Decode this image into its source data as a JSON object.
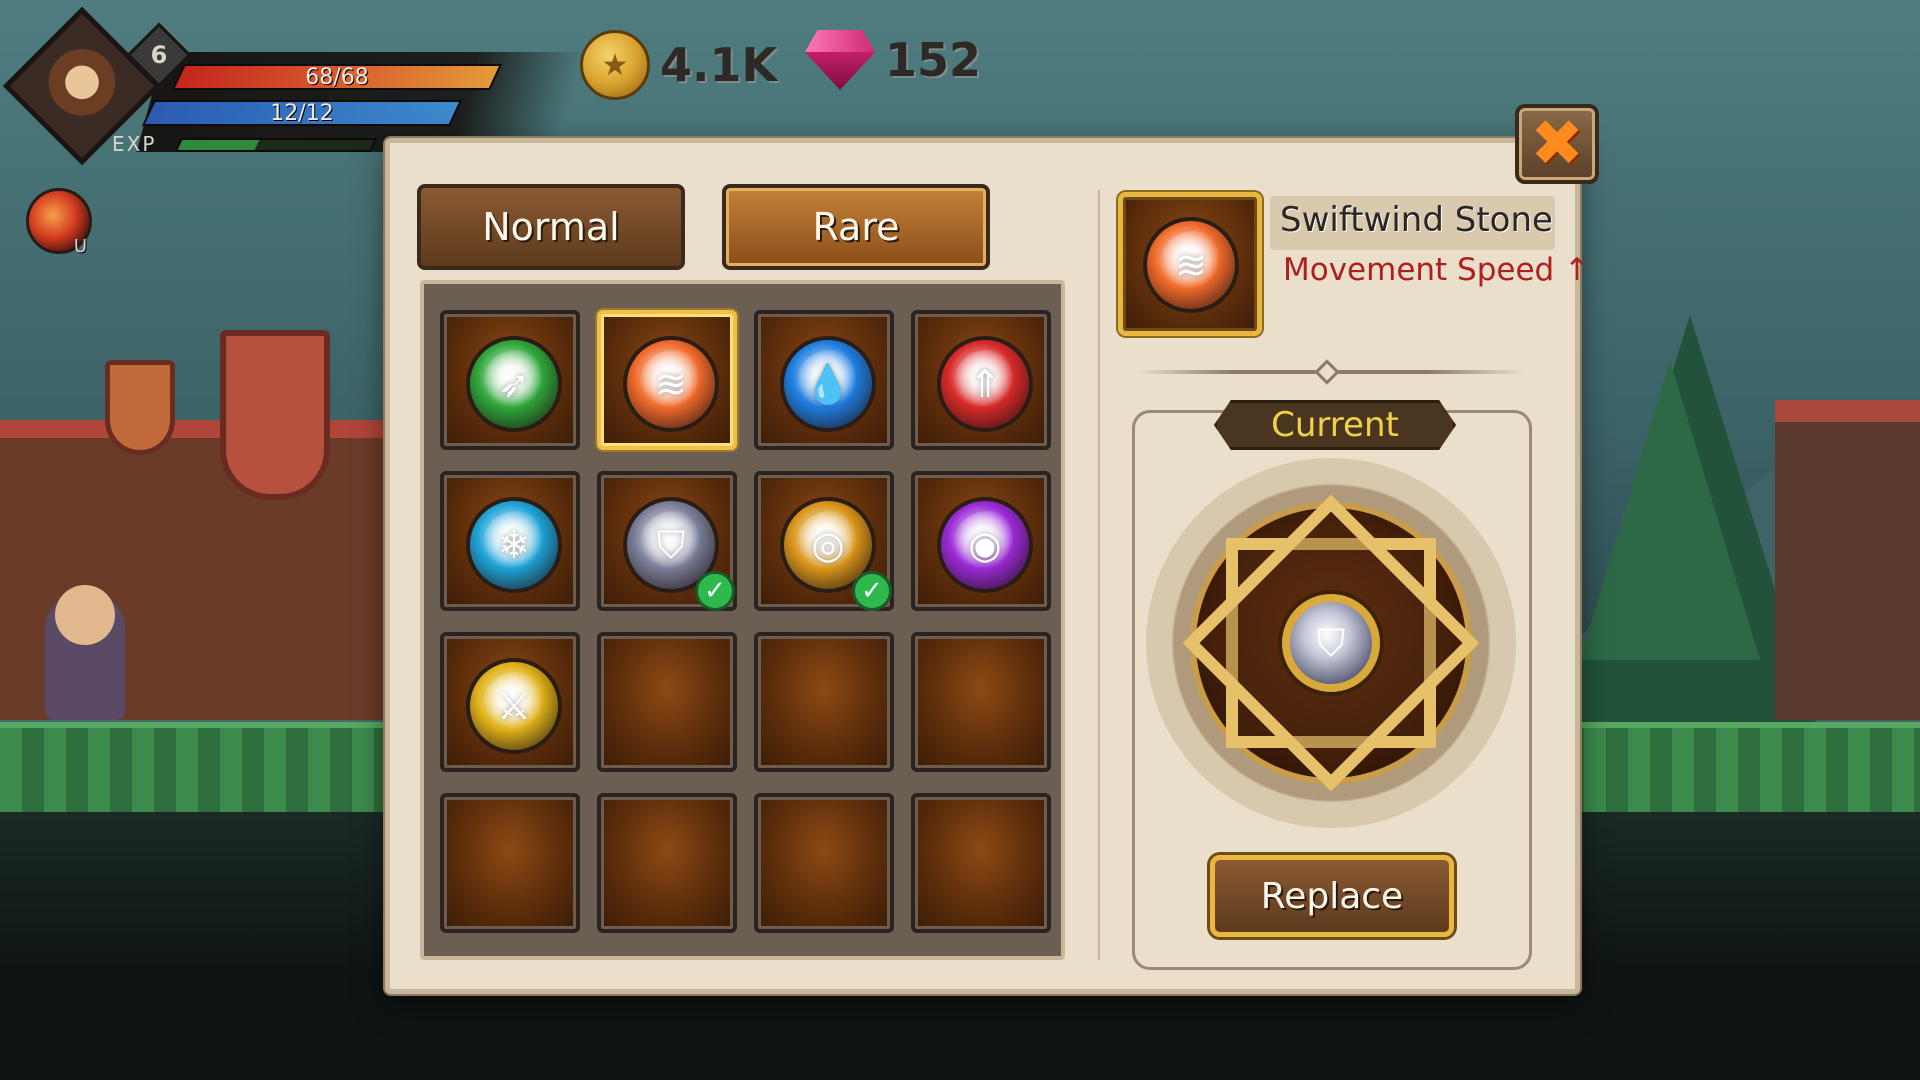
{
  "hud": {
    "level": "6",
    "hp_text": "68/68",
    "mp_text": "12/12",
    "exp_label": "EXP",
    "exp_fraction": 0.4,
    "skill_key": "U",
    "gold": "4.1K",
    "gems": "152"
  },
  "tabs": {
    "normal_label": "Normal",
    "rare_label": "Rare",
    "active": "rare"
  },
  "stones": [
    {
      "icon": "winged-boot-icon",
      "glyph": "➶",
      "color": "#2fa63a",
      "equipped": false,
      "selected": false
    },
    {
      "icon": "swiftwind-swirl-icon",
      "glyph": "≋",
      "color": "#f06a2a",
      "equipped": false,
      "selected": true
    },
    {
      "icon": "water-drop-icon",
      "glyph": "💧",
      "color": "#1f7ee0",
      "equipped": false,
      "selected": false
    },
    {
      "icon": "flame-tree-icon",
      "glyph": "⇑",
      "color": "#d92a2a",
      "equipped": false,
      "selected": false
    },
    {
      "icon": "snowflake-icon",
      "glyph": "❄",
      "color": "#1fa2d6",
      "equipped": false,
      "selected": false
    },
    {
      "icon": "shield-icon",
      "glyph": "⛉",
      "color": "#7a7e98",
      "equipped": true,
      "selected": false
    },
    {
      "icon": "vortex-icon",
      "glyph": "◎",
      "color": "#d9951a",
      "equipped": true,
      "selected": false
    },
    {
      "icon": "eye-icon",
      "glyph": "◉",
      "color": "#9a2ad6",
      "equipped": false,
      "selected": false
    },
    {
      "icon": "sword-burst-icon",
      "glyph": "⚔",
      "color": "#e0b21a",
      "equipped": false,
      "selected": false
    }
  ],
  "empty_slot_count": 7,
  "selected_stone": {
    "name": "Swiftwind Stone",
    "description": "Movement Speed ↑",
    "icon": "swiftwind-swirl-icon",
    "glyph": "≋",
    "color": "#f06a2a"
  },
  "current": {
    "label": "Current",
    "icon": "shield-icon",
    "glyph": "⛉"
  },
  "replace_label": "Replace",
  "close_glyph": "✖"
}
